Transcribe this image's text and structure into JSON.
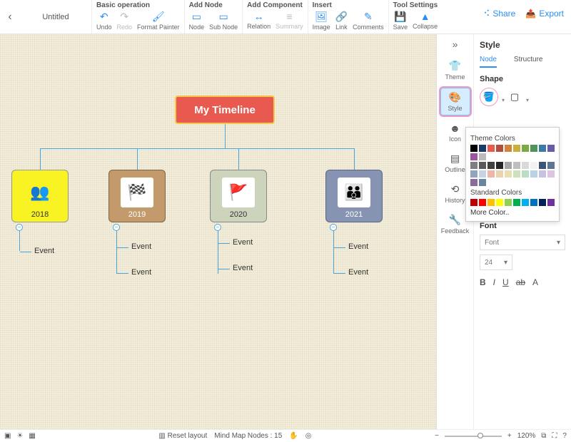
{
  "doc_title": "Untitled",
  "ribbon": {
    "groups": [
      {
        "title": "Basic operation",
        "items": [
          {
            "id": "undo",
            "label": "Undo",
            "icon": "↶"
          },
          {
            "id": "redo",
            "label": "Redo",
            "icon": "↷",
            "disabled": true
          },
          {
            "id": "format-painter",
            "label": "Format Painter",
            "icon": "🖌"
          }
        ]
      },
      {
        "title": "Add Node",
        "items": [
          {
            "id": "node",
            "label": "Node",
            "icon": "▭"
          },
          {
            "id": "sub-node",
            "label": "Sub Node",
            "icon": "▭"
          }
        ]
      },
      {
        "title": "Add Component",
        "items": [
          {
            "id": "relation",
            "label": "Relation",
            "icon": "↔"
          },
          {
            "id": "summary",
            "label": "Summary",
            "icon": "≡",
            "disabled": true
          }
        ]
      },
      {
        "title": "Insert",
        "items": [
          {
            "id": "image",
            "label": "Image",
            "icon": "🖼"
          },
          {
            "id": "link",
            "label": "Link",
            "icon": "🔗"
          },
          {
            "id": "comments",
            "label": "Comments",
            "icon": "✎"
          }
        ]
      },
      {
        "title": "Tool Settings",
        "items": [
          {
            "id": "save",
            "label": "Save",
            "icon": "💾"
          },
          {
            "id": "collapse",
            "label": "Collapse",
            "icon": "▲"
          }
        ]
      }
    ],
    "share": "Share",
    "export": "Export"
  },
  "rail": [
    {
      "id": "theme",
      "label": "Theme",
      "icon": "👕"
    },
    {
      "id": "style",
      "label": "Style",
      "icon": "🎨",
      "active": true
    },
    {
      "id": "icon",
      "label": "Icon",
      "icon": "☻"
    },
    {
      "id": "outline",
      "label": "Outline",
      "icon": "▤"
    },
    {
      "id": "history",
      "label": "History",
      "icon": "⟲"
    },
    {
      "id": "feedback",
      "label": "Feedback",
      "icon": "🔧"
    }
  ],
  "panel": {
    "title": "Style",
    "tabs": {
      "node": "Node",
      "structure": "Structure",
      "active": "node"
    },
    "shape_label": "Shape",
    "theme_colors_label": "Theme Colors",
    "standard_colors_label": "Standard Colors",
    "more_color": "More Color..",
    "font_label": "Font",
    "font_placeholder": "Font",
    "font_size": "24",
    "theme_colors": [
      "#000000",
      "#1c3a66",
      "#e85a4f",
      "#b34d38",
      "#d1843b",
      "#c9b03a",
      "#7da843",
      "#4f9556",
      "#3f7aa6",
      "#6b5aa6",
      "#9e55a0",
      "#bbbbbb"
    ],
    "gray_shades": [
      "#7f7f7f",
      "#595959",
      "#404040",
      "#262626",
      "#a6a6a6",
      "#bfbfbf",
      "#d9d9d9",
      "#f2f2f2",
      "#3b5576",
      "#5c7694",
      "#8ea5bd",
      "#c7d3e2",
      "#f0b4ab",
      "#e9d3ae",
      "#e8deb0",
      "#cfe0bd",
      "#b9ddc6",
      "#b7d2e6",
      "#c9c1e4",
      "#e0c3e2",
      "#8a6b9c",
      "#6784a3"
    ],
    "standard_colors": [
      "#c00000",
      "#ff0000",
      "#ffc000",
      "#ffff00",
      "#92d050",
      "#00b050",
      "#00b0f0",
      "#0070c0",
      "#002060",
      "#7030a0"
    ]
  },
  "mindmap": {
    "root": "My Timeline",
    "years": [
      {
        "year": "2018",
        "events": [
          "Event"
        ]
      },
      {
        "year": "2019",
        "events": [
          "Event",
          "Event"
        ]
      },
      {
        "year": "2020",
        "events": [
          "Event",
          "Event"
        ]
      },
      {
        "year": "2021",
        "events": [
          "Event",
          "Event"
        ]
      }
    ]
  },
  "bottom": {
    "reset": "Reset layout",
    "nodes_label": "Mind Map Nodes :",
    "node_count": "15",
    "zoom": "120%"
  }
}
